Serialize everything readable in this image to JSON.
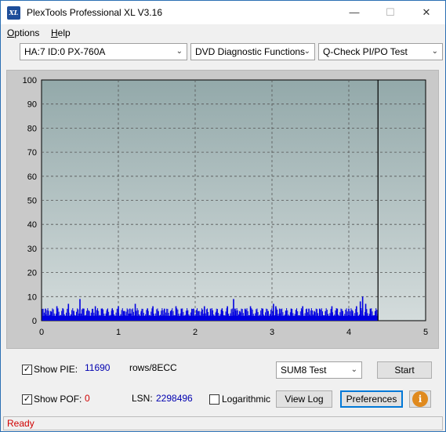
{
  "window": {
    "title": "PlexTools Professional XL V3.16",
    "icon_label": "XL",
    "controls": {
      "minimize": "—",
      "maximize": "☐",
      "close": "✕"
    }
  },
  "menu": {
    "items": [
      {
        "label": "Options",
        "accel": "O",
        "rest": "ptions"
      },
      {
        "label": "Help",
        "accel": "H",
        "rest": "elp"
      }
    ]
  },
  "toolbar": {
    "drive_select": "HA:7 ID:0  PX-760A",
    "function_select": "DVD Diagnostic Functions",
    "test_select": "Q-Check PI/PO Test"
  },
  "chart_data": {
    "type": "bar",
    "xlim": [
      0,
      5
    ],
    "ylim": [
      0,
      100
    ],
    "x_ticks": [
      "0",
      "1",
      "2",
      "3",
      "4",
      "5"
    ],
    "y_ticks": [
      "0",
      "10",
      "20",
      "30",
      "40",
      "50",
      "60",
      "70",
      "80",
      "90",
      "100"
    ],
    "grid": true,
    "end_marker_x": 4.38,
    "series": [
      {
        "color": "#0000e0",
        "baseline": 2,
        "x": [
          0.05,
          0.12,
          0.2,
          0.28,
          0.35,
          0.42,
          0.5,
          0.55,
          0.62,
          0.7,
          0.78,
          0.85,
          0.92,
          1.0,
          1.08,
          1.15,
          1.22,
          1.3,
          1.38,
          1.45,
          1.52,
          1.6,
          1.68,
          1.75,
          1.82,
          1.9,
          1.98,
          2.05,
          2.12,
          2.2,
          2.28,
          2.35,
          2.42,
          2.5,
          2.52,
          2.58,
          2.65,
          2.72,
          2.8,
          2.88,
          2.95,
          3.02,
          3.05,
          3.1,
          3.18,
          3.25,
          3.32,
          3.4,
          3.48,
          3.55,
          3.62,
          3.7,
          3.78,
          3.85,
          3.92,
          4.0,
          4.05,
          4.1,
          4.15,
          4.18,
          4.22,
          4.28,
          4.35
        ],
        "values": [
          5,
          4,
          6,
          5,
          7,
          4,
          9,
          5,
          4,
          6,
          5,
          4,
          5,
          6,
          4,
          5,
          7,
          4,
          5,
          6,
          4,
          5,
          4,
          6,
          5,
          4,
          5,
          4,
          6,
          5,
          4,
          5,
          6,
          9,
          5,
          4,
          5,
          6,
          4,
          5,
          4,
          7,
          6,
          5,
          4,
          5,
          4,
          6,
          5,
          4,
          5,
          4,
          6,
          5,
          4,
          5,
          4,
          6,
          8,
          10,
          7,
          5,
          4
        ]
      }
    ]
  },
  "stats": {
    "show_pie_label": "Show PIE:",
    "pie_value": "11690",
    "pie_unit": "rows/8ECC",
    "show_pof_label": "Show POF:",
    "pof_value": "0",
    "lsn_label": "LSN:",
    "lsn_value": "2298496",
    "logarithmic_label": "Logarithmic",
    "show_pie_checked": "✓",
    "show_pof_checked": "✓"
  },
  "controls": {
    "test_mode_select": "SUM8 Test",
    "start_button": "Start",
    "view_log_button": "View Log",
    "preferences_button": "Preferences",
    "info_icon": "i"
  },
  "status": {
    "text": "Ready"
  }
}
